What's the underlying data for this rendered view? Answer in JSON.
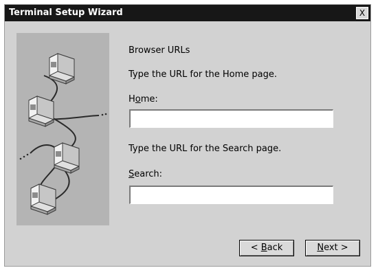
{
  "window": {
    "title": "Terminal Setup Wizard",
    "close_label": "X"
  },
  "content": {
    "heading": "Browser URLs",
    "home_prompt": "Type the URL for the Home page.",
    "home_label_pre": "H",
    "home_label_mnemonic": "o",
    "home_label_post": "me:",
    "home_value": "",
    "search_prompt": "Type the URL for the Search page.",
    "search_label_mnemonic": "S",
    "search_label_post": "earch:",
    "search_value": ""
  },
  "buttons": {
    "back_pre": "< ",
    "back_mnemonic": "B",
    "back_post": "ack",
    "next_mnemonic": "N",
    "next_post": "ext >"
  },
  "illustration": {
    "icon": "network-computers-icon"
  }
}
